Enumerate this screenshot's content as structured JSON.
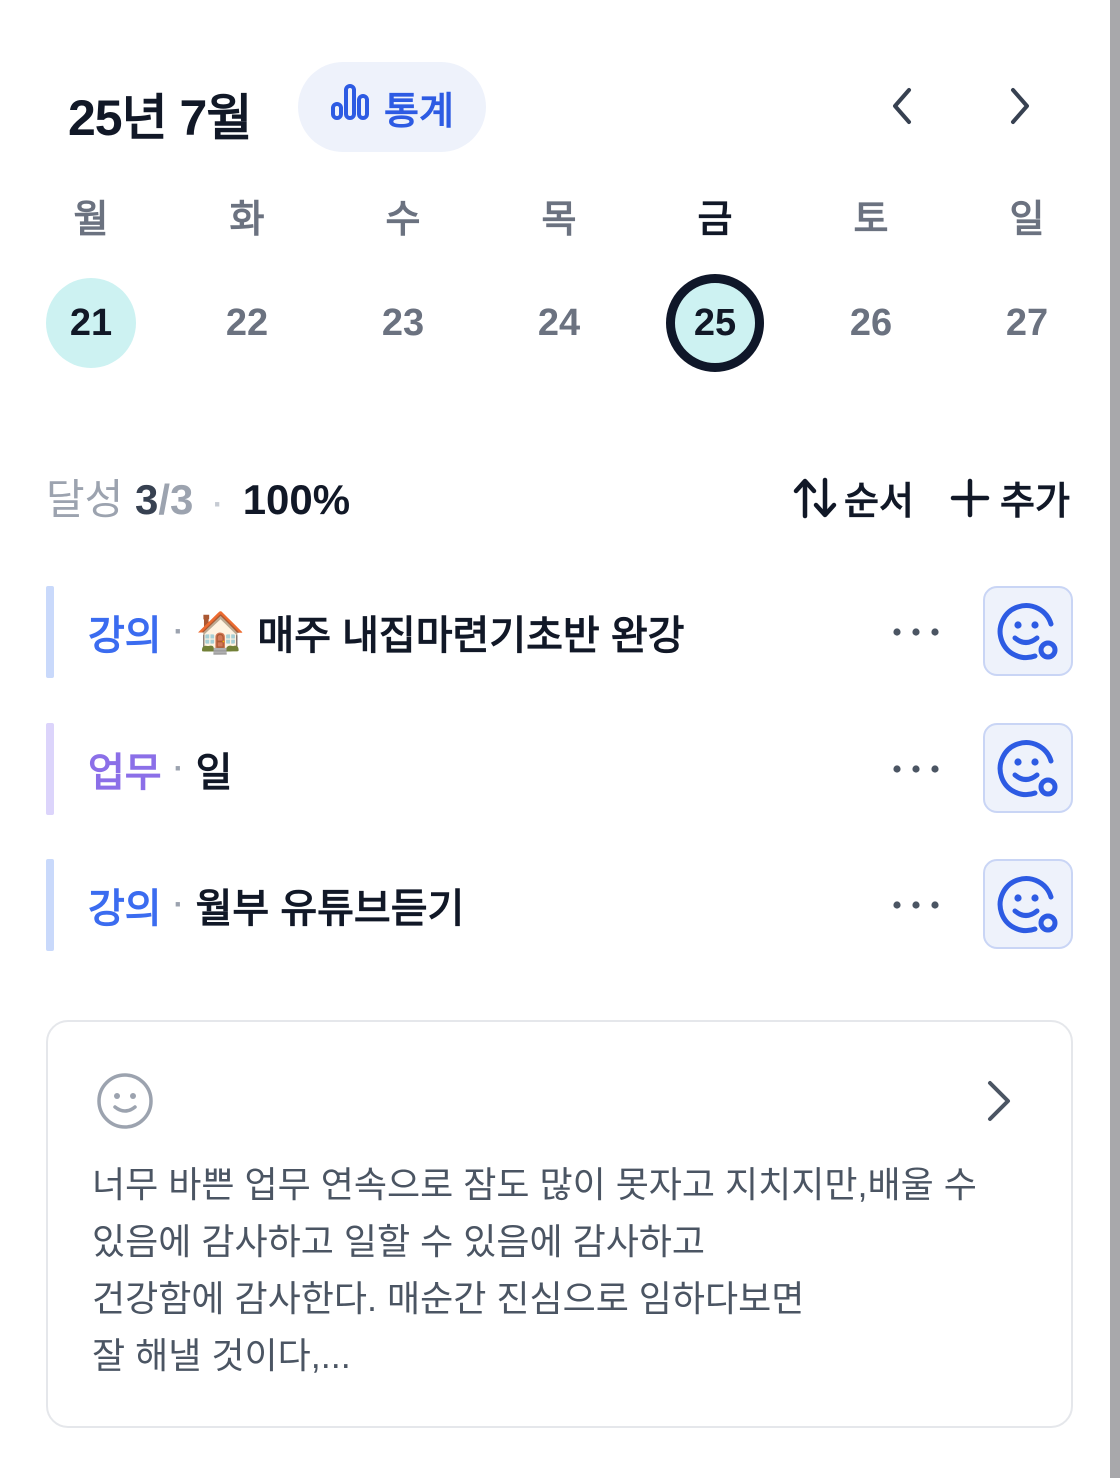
{
  "header": {
    "month_title": "25년 7월",
    "stats_label": "통계",
    "accent_color": "#2d5be3"
  },
  "week": {
    "days": [
      {
        "name": "월",
        "num": "21",
        "state": "filled"
      },
      {
        "name": "화",
        "num": "22",
        "state": "normal"
      },
      {
        "name": "수",
        "num": "23",
        "state": "normal"
      },
      {
        "name": "목",
        "num": "24",
        "state": "normal"
      },
      {
        "name": "금",
        "num": "25",
        "state": "today"
      },
      {
        "name": "토",
        "num": "26",
        "state": "normal"
      },
      {
        "name": "일",
        "num": "27",
        "state": "normal"
      }
    ]
  },
  "summary": {
    "label": "달성",
    "done": "3",
    "total": "/3",
    "percent": "100%"
  },
  "toolbar": {
    "sort_label": "순서",
    "add_label": "추가"
  },
  "tasks": [
    {
      "category": "강의",
      "emoji": "🏠",
      "title": "매주 내집마련기초반 완강",
      "category_color": "#3b6cf0",
      "bar_color": "#c9d9fb"
    },
    {
      "category": "업무",
      "emoji": "",
      "title": "일",
      "category_color": "#8b6fe8",
      "bar_color": "#dcd4fb"
    },
    {
      "category": "강의",
      "emoji": "",
      "title": "월부 유튜브듣기",
      "category_color": "#3b6cf0",
      "bar_color": "#c9d9fb"
    }
  ],
  "diary": {
    "text": "너무 바쁜 업무 연속으로 잠도 많이 못자고 지치지만,배울 수\n있음에 감사하고 일할 수 있음에 감사하고\n건강함에 감사한다. 매순간 진심으로 임하다보면\n잘 해낼 것이다,..."
  },
  "icons": {
    "stats": "bar-chart-icon",
    "prev": "chevron-left-icon",
    "next": "chevron-right-icon",
    "sort": "sort-arrows-icon",
    "add": "plus-icon",
    "more": "more-dots-icon",
    "mood": "mood-smile-icon",
    "diary_mood": "smile-icon",
    "diary_open": "chevron-right-icon"
  }
}
